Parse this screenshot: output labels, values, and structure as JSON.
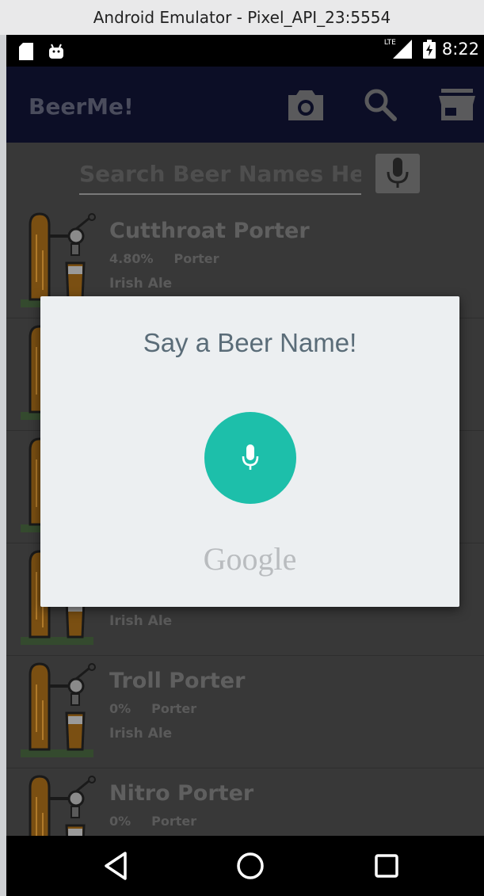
{
  "window": {
    "title": "Android Emulator - Pixel_API_23:5554"
  },
  "status_bar": {
    "time": "8:22",
    "network": "LTE"
  },
  "app_bar": {
    "title": "BeerMe!",
    "icons": [
      "camera-icon",
      "search-icon",
      "store-icon"
    ]
  },
  "search": {
    "placeholder": "Search Beer Names Here!"
  },
  "beers": [
    {
      "name": "Cutthroat Porter",
      "abv": "4.80%",
      "style": "Porter",
      "brewery": "Irish Ale"
    },
    {
      "name": "",
      "abv": "",
      "style": "",
      "brewery": ""
    },
    {
      "name": "",
      "abv": "",
      "style": "",
      "brewery": ""
    },
    {
      "name": "",
      "abv": "",
      "style": "",
      "brewery": "Irish Ale"
    },
    {
      "name": "Troll Porter",
      "abv": "0%",
      "style": "Porter",
      "brewery": "Irish Ale"
    },
    {
      "name": "Nitro Porter",
      "abv": "0%",
      "style": "Porter",
      "brewery": ""
    }
  ],
  "dialog": {
    "title": "Say a Beer Name!",
    "brand": "Google"
  },
  "colors": {
    "app_bar": "#0c0e26",
    "voice_button": "#1dbfaa",
    "dialog_bg": "#eceff1"
  }
}
